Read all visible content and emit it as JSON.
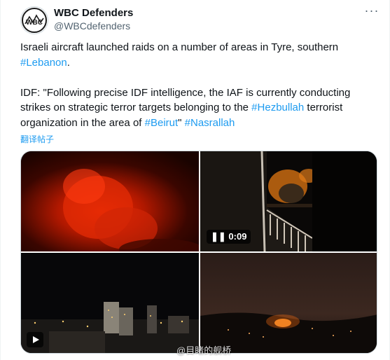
{
  "author": {
    "name": "WBC Defenders",
    "handle": "@WBCdefenders",
    "avatar_text": "WBC"
  },
  "tweet": {
    "para1_text": "Israeli aircraft launched raids on a number of areas in Tyre, southern ",
    "para1_tag": "#Lebanon",
    "para1_end": ".",
    "para2_a": "IDF: \"Following precise IDF intelligence, the IAF is currently conducting strikes on strategic terror targets belonging to the ",
    "para2_tag1": "#Hezbullah",
    "para2_b": " terrorist organization in the area of ",
    "para2_tag2": "#Beirut",
    "para2_c": "\" ",
    "para2_tag3": "#Nasrallah"
  },
  "translate_label": "翻译帖子",
  "media": {
    "video_duration": "0:09",
    "watermark": "@目睹的舰桥"
  },
  "icons": [
    "more-icon",
    "pause-icon",
    "play-icon"
  ],
  "colors": {
    "link": "#1d9bf0",
    "text": "#0f1419",
    "muted": "#536471"
  }
}
